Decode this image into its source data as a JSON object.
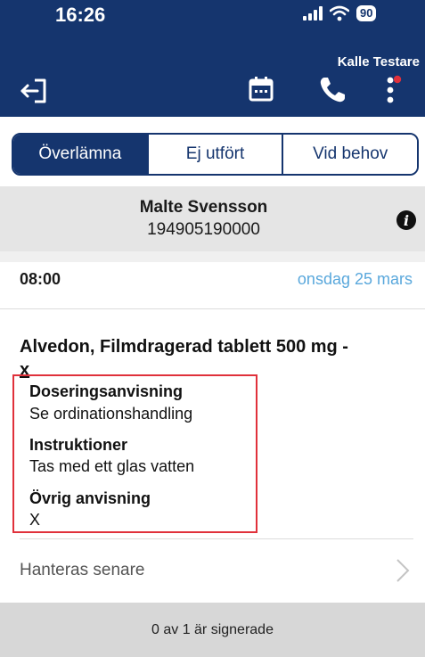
{
  "status_bar": {
    "time": "16:26",
    "battery": "90"
  },
  "header": {
    "user_name": "Kalle Testare"
  },
  "icons": {
    "logout": "logout-icon",
    "calendar": "calendar-icon",
    "phone": "phone-icon",
    "menu": "more-vertical-icon",
    "info": "info-icon",
    "chevron": "chevron-right-icon"
  },
  "colors": {
    "header": "#15356e",
    "accent": "#5aa8dc",
    "highlight_border": "#e0313b",
    "notification_dot": "#e0313b"
  },
  "tabs": [
    {
      "label": "Överlämna",
      "selected": true
    },
    {
      "label": "Ej utfört",
      "selected": false
    },
    {
      "label": "Vid behov",
      "selected": false
    }
  ],
  "patient": {
    "name": "Malte Svensson",
    "id": "194905190000"
  },
  "dose": {
    "time": "08:00",
    "date": "onsdag 25 mars",
    "medication": "Alvedon, Filmdragerad tablett 500 mg -",
    "medication_suffix": "x",
    "details": [
      {
        "label": "Doseringsanvisning",
        "value": "Se ordinationshandling"
      },
      {
        "label": "Instruktioner",
        "value": "Tas med ett glas vatten"
      },
      {
        "label": "Övrig anvisning",
        "value": "X"
      }
    ],
    "later_label": "Hanteras senare"
  },
  "footer": {
    "signed_status": "0 av 1 är signerade"
  }
}
